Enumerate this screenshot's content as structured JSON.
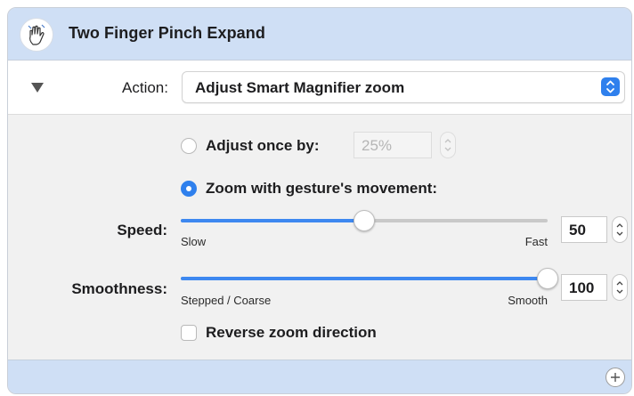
{
  "header": {
    "title": "Two Finger Pinch Expand",
    "icon": "hand-pinch-icon"
  },
  "action": {
    "label": "Action:",
    "selected": "Adjust Smart Magnifier zoom",
    "disclosure_icon": "disclosure-triangle-icon",
    "popup_icon": "chevron-up-down-icon"
  },
  "options": {
    "adjust_once": {
      "label": "Adjust once by:",
      "value": "25%",
      "selected": false,
      "enabled": false
    },
    "zoom_with_gesture": {
      "label": "Zoom with gesture's movement:",
      "selected": true
    }
  },
  "speed": {
    "label": "Speed:",
    "min_label": "Slow",
    "max_label": "Fast",
    "value": "50",
    "fraction": 0.5
  },
  "smoothness": {
    "label": "Smoothness:",
    "min_label": "Stepped / Coarse",
    "max_label": "Smooth",
    "value": "100",
    "fraction": 1.0
  },
  "reverse": {
    "label": "Reverse zoom direction",
    "checked": false
  },
  "footer": {
    "add_icon": "plus-icon"
  },
  "colors": {
    "accent": "#2f80ed",
    "header_bg": "#cfdff5",
    "panel_bg": "#f1f1f1"
  }
}
